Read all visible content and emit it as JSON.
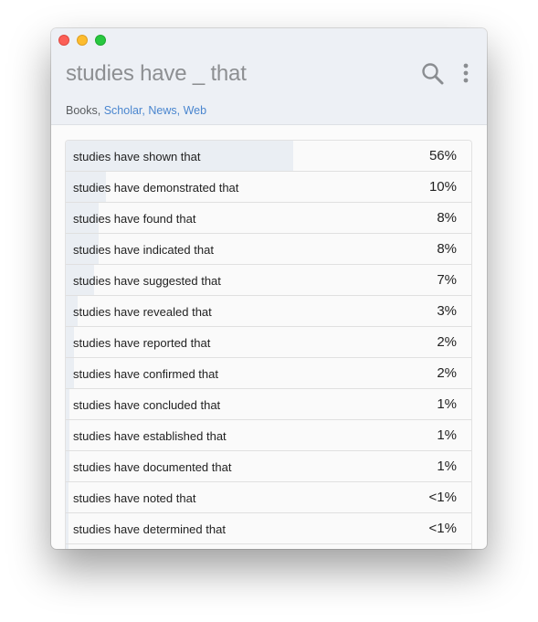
{
  "window": {
    "query": "studies have _ that"
  },
  "icons": {
    "search": "search-icon",
    "menu": "more-vertical-icon"
  },
  "sources": {
    "books": "Books,",
    "scholar": "Scholar,",
    "news": "News,",
    "web": "Web"
  },
  "results": [
    {
      "phrase": "studies have shown that",
      "percent": "56%",
      "share": 0.56
    },
    {
      "phrase": "studies have demonstrated that",
      "percent": "10%",
      "share": 0.1
    },
    {
      "phrase": "studies have found that",
      "percent": "8%",
      "share": 0.08
    },
    {
      "phrase": "studies have indicated that",
      "percent": "8%",
      "share": 0.08
    },
    {
      "phrase": "studies have suggested that",
      "percent": "7%",
      "share": 0.07
    },
    {
      "phrase": "studies have revealed that",
      "percent": "3%",
      "share": 0.03
    },
    {
      "phrase": "studies have reported that",
      "percent": "2%",
      "share": 0.02
    },
    {
      "phrase": "studies have confirmed that",
      "percent": "2%",
      "share": 0.02
    },
    {
      "phrase": "studies have concluded that",
      "percent": "1%",
      "share": 0.01
    },
    {
      "phrase": "studies have established that",
      "percent": "1%",
      "share": 0.01
    },
    {
      "phrase": "studies have documented that",
      "percent": "1%",
      "share": 0.01
    },
    {
      "phrase": "studies have noted that",
      "percent": "<1%",
      "share": 0.004
    },
    {
      "phrase": "studies have determined that",
      "percent": "<1%",
      "share": 0.004
    },
    {
      "phrase": "",
      "percent": "",
      "share": 0.003
    }
  ],
  "colors": {
    "header_bg": "#edf0f5",
    "bar_fill": "#eaeef3",
    "link": "#4a86cf",
    "close": "#fc5f57",
    "minimize": "#fdbc2e",
    "zoom": "#28c840"
  }
}
